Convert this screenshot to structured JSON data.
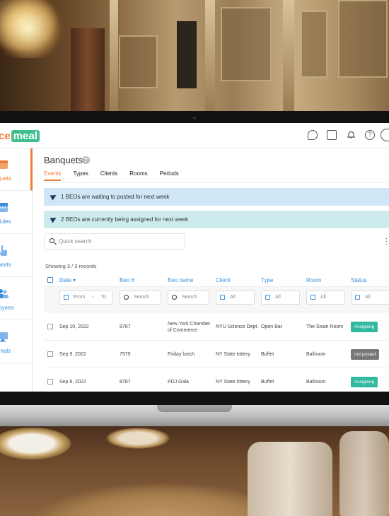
{
  "app": {
    "logo_prefix": "ce",
    "logo_brand": "meal"
  },
  "header_icons": [
    "chat-icon",
    "document-icon",
    "bell-icon",
    "help-icon",
    "user-icon"
  ],
  "sidebar": {
    "items": [
      {
        "label": "nquets",
        "icon": "banquets-icon",
        "active": true
      },
      {
        "label": "edules",
        "icon": "calendar-icon",
        "active": false
      },
      {
        "label": "quests",
        "icon": "hand-icon",
        "active": false
      },
      {
        "label": "ployees",
        "icon": "users-icon",
        "active": false
      },
      {
        "label": "minals",
        "icon": "monitor-icon",
        "active": false
      }
    ]
  },
  "page": {
    "title": "Banquets",
    "tabs": [
      "Events",
      "Types",
      "Clients",
      "Rooms",
      "Periods"
    ],
    "active_tab": "Events"
  },
  "alerts": {
    "waiting": "1 BEOs are waiting to posted for next week",
    "assigned": "2 BEOs are currently being assigned for next week"
  },
  "search": {
    "placeholder": "Quick search"
  },
  "records_text": "Showing 3 / 3 records",
  "table": {
    "columns": [
      "Date",
      "Beo #",
      "Beo name",
      "Client",
      "Type",
      "Room",
      "Status"
    ],
    "filters": {
      "date_from": "From",
      "date_sep": "-",
      "date_to": "To",
      "beo_search": "Search",
      "name_search": "Search",
      "client": "All",
      "type": "All",
      "room": "All",
      "status": "All"
    },
    "rows": [
      {
        "date": "Sep 10, 2022",
        "beo": "8787",
        "name": "New York Chamber of Commerce",
        "client": "NYU Science Dept.",
        "type": "Open Bar",
        "room": "The Swan Room",
        "status": "Assigning"
      },
      {
        "date": "Sep 9, 2022",
        "beo": "7979",
        "name": "Friday lunch",
        "client": "NY State lottery",
        "type": "Buffet",
        "room": "Ballroom",
        "status": "not posted"
      },
      {
        "date": "Sep 8, 2022",
        "beo": "8787",
        "name": "PDJ Gala",
        "client": "NY State lottery",
        "type": "Buffet",
        "room": "Ballroom",
        "status": "Assigning"
      }
    ]
  },
  "colors": {
    "accent": "#f07c34",
    "brand_green": "#3fbf8e",
    "link_blue": "#3a8fd8",
    "assigning": "#33b8a2",
    "not_posted": "#777777"
  }
}
